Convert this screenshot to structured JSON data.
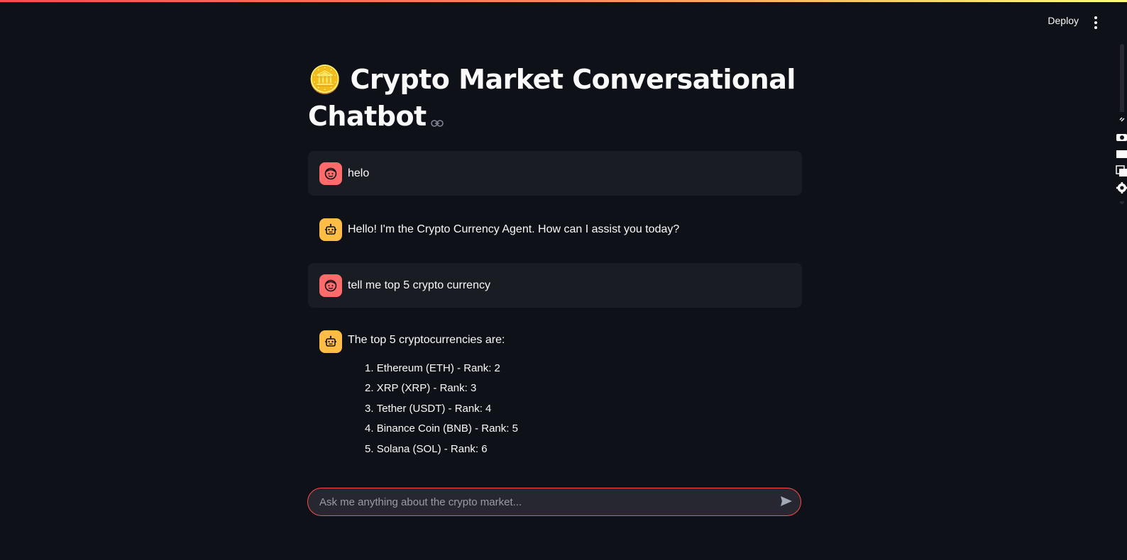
{
  "header": {
    "deploy_label": "Deploy"
  },
  "title": "🪙 Crypto Market Conversational Chatbot",
  "messages": [
    {
      "role": "user",
      "text": "helo"
    },
    {
      "role": "assistant",
      "text": "Hello! I'm the Crypto Currency Agent. How can I assist you today?"
    },
    {
      "role": "user",
      "text": "tell me top 5 crypto currency"
    },
    {
      "role": "assistant",
      "text": "The top 5 cryptocurrencies are:",
      "list": [
        "Ethereum (ETH) - Rank: 2",
        "XRP (XRP) - Rank: 3",
        "Tether (USDT) - Rank: 4",
        "Binance Coin (BNB) - Rank: 5",
        "Solana (SOL) - Rank: 6"
      ]
    }
  ],
  "chat_input": {
    "placeholder": "Ask me anything about the crypto market..."
  },
  "colors": {
    "background": "#0e1117",
    "user_avatar": "#ff6b6b",
    "assistant_avatar": "#ffbd45",
    "input_border": "#ff4b4b"
  }
}
